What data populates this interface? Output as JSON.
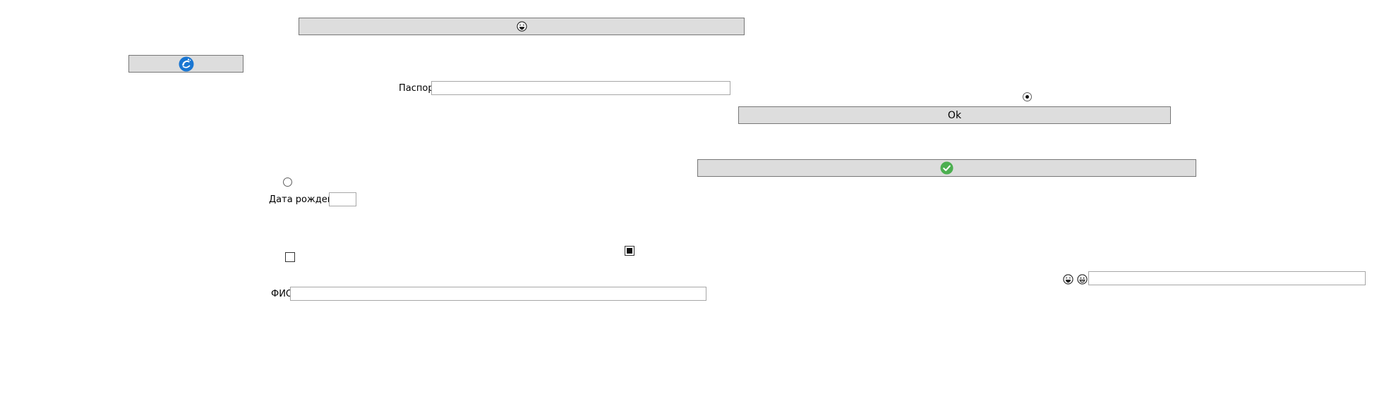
{
  "form": {
    "passport_label": "Паспорт",
    "passport_value": "",
    "birthdate_label": "Дата рождения",
    "birthdate_value": "",
    "fio_label": "ФИО",
    "fio_value": "",
    "right_field_value": ""
  },
  "buttons": {
    "top_icon": "smiley-face-icon",
    "small_icon": "dolphin-logo-icon",
    "ok_label": "Ok",
    "confirm_icon": "green-checkmark-icon"
  },
  "controls": {
    "radio_top_checked": true,
    "radio_left_checked": false,
    "checkbox_left_checked": false,
    "checkbox_middle_checked": true
  },
  "icons": {
    "smiley_1": "laughing-face-icon",
    "smiley_2": "grinning-face-icon"
  },
  "colors": {
    "button_bg": "#dddddd",
    "button_border": "#777777",
    "field_border": "#a7a7a7",
    "dolphin_blue": "#1976d2",
    "check_green": "#4caf50"
  }
}
